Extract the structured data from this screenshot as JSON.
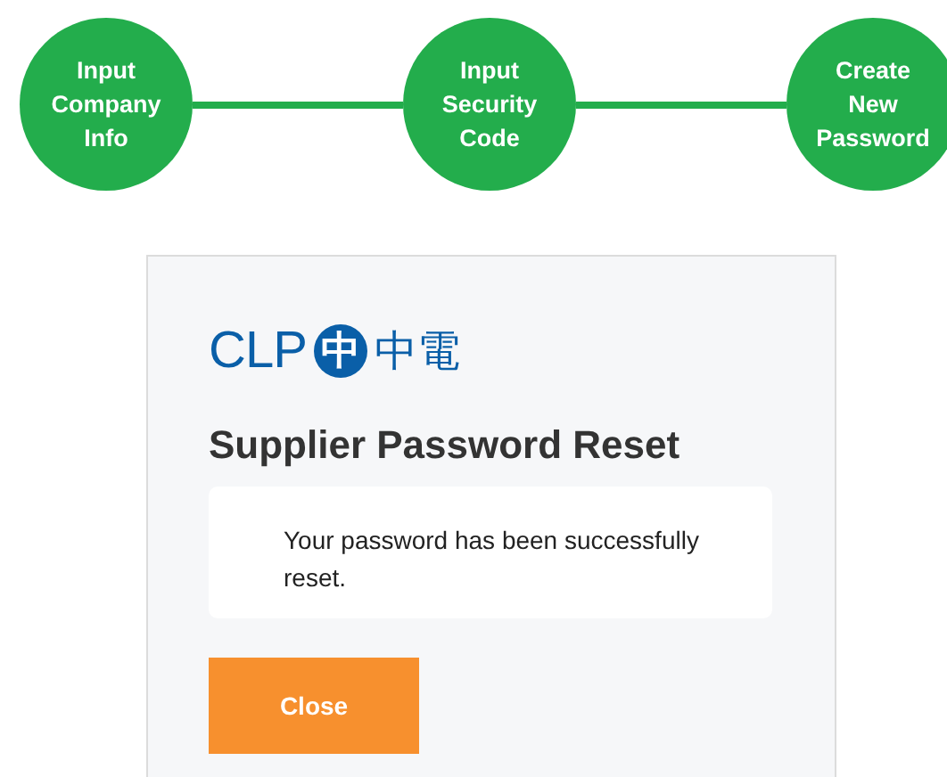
{
  "steps": [
    {
      "label": "Input Company Info"
    },
    {
      "label": "Input Security Code"
    },
    {
      "label": "Create New Password"
    }
  ],
  "card": {
    "logo": {
      "latin": "CLP",
      "mark": "中",
      "chinese": "中電"
    },
    "title": "Supplier Password Reset",
    "message": "Your password has been successfully reset.",
    "button": "Close"
  }
}
